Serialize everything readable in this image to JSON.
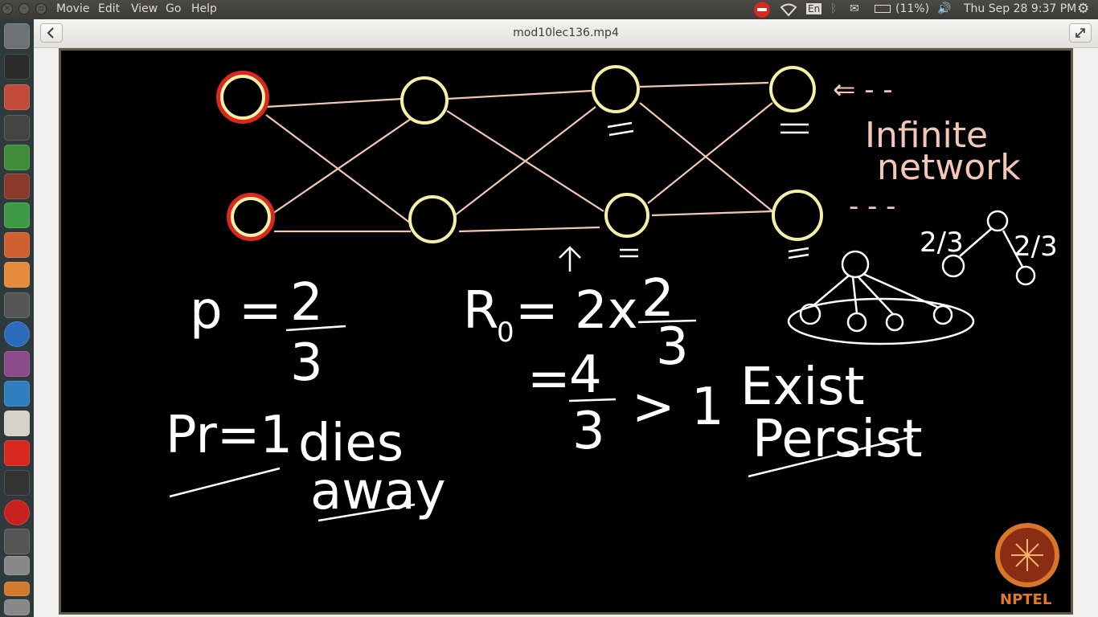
{
  "menu": {
    "items": [
      "Movie",
      "Edit",
      "View",
      "Go",
      "Help"
    ]
  },
  "tray": {
    "keyboard": "En",
    "battery": "(11%)",
    "datetime": "Thu Sep 28  9:37 PM"
  },
  "header": {
    "title": "mod10lec136.mp4"
  },
  "video": {
    "annotations": {
      "infinite": "Infinite",
      "network": "network",
      "p_label": "p =",
      "p_num": "2",
      "p_den": "3",
      "r0_label": "R",
      "r0_sub": "0",
      "r0_expr": "= 2x",
      "r0_num": "2",
      "r0_den": "3",
      "eq": "=",
      "frac_num": "4",
      "frac_den": "3",
      "gt": "> 1",
      "pr": "Pr=1",
      "dies": "dies",
      "away": "away",
      "exist": "Exist",
      "persist": "Persist",
      "two_thirds_left": "2/3",
      "two_thirds_right": "2/3",
      "dots": "- - -"
    },
    "logo": "NPTEL"
  },
  "colors": {
    "accent_red": "#d9281f",
    "node_yellow": "#f4f0a6",
    "edge_pink": "#f3c7b6"
  }
}
